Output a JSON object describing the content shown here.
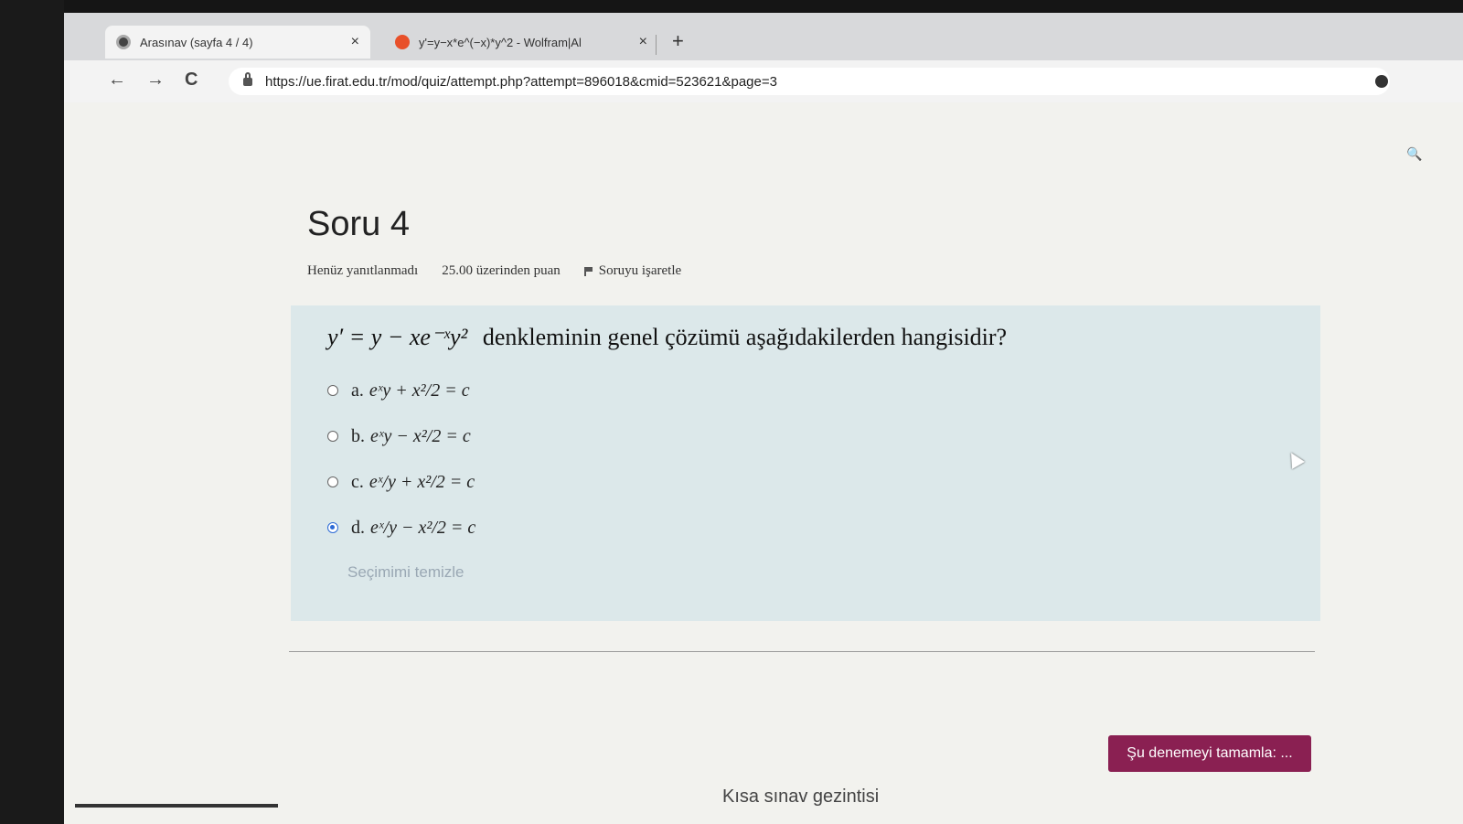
{
  "browser": {
    "tabs": [
      {
        "title": "Arasınav (sayfa 4 / 4)",
        "active": true
      },
      {
        "title": "y'=y−x*e^(−x)*y^2 - Wolfram|Al",
        "active": false
      }
    ],
    "new_tab_label": "+",
    "close_label": "×",
    "back_label": "←",
    "forward_label": "→",
    "reload_label": "C",
    "url": "https://ue.firat.edu.tr/mod/quiz/attempt.php?attempt=896018&cmid=523621&page=3"
  },
  "question": {
    "title": "Soru 4",
    "status": "Henüz yanıtlanmadı",
    "points": "25.00 üzerinden puan",
    "flag_label": "Soruyu işaretle",
    "equation": "y′ = y − xe⁻ˣy²",
    "text": "denkleminin genel çözümü aşağıdakilerden hangisidir?",
    "answers": [
      {
        "letter": "a.",
        "expr": "eˣy + x²/2 = c",
        "selected": false
      },
      {
        "letter": "b.",
        "expr": "eˣy − x²/2 = c",
        "selected": false
      },
      {
        "letter": "c.",
        "expr": "eˣ/y + x²/2 = c",
        "selected": false
      },
      {
        "letter": "d.",
        "expr": "eˣ/y − x²/2 = c",
        "selected": true
      }
    ],
    "clear_label": "Seçimimi temizle"
  },
  "finish_button": "Şu denemeyi tamamla: ...",
  "nav_heading": "Kısa sınav gezintisi",
  "colors": {
    "accent": "#8a2052",
    "question_bg": "#dce8ea",
    "radio_selected": "#2d6bd6"
  }
}
